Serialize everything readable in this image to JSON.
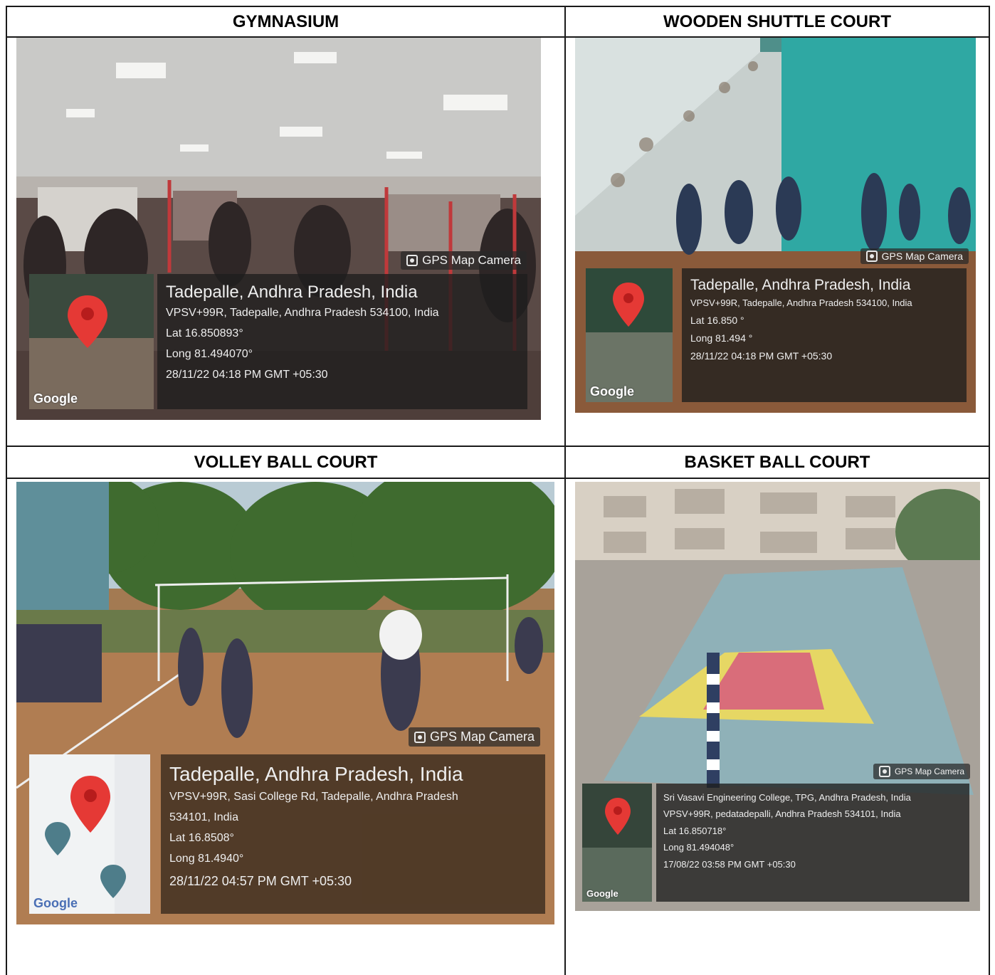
{
  "cells": [
    {
      "title": "GYMNASIUM",
      "badge": "GPS Map Camera",
      "place": "Tadepalle, Andhra Pradesh, India",
      "address": "VPSV+99R, Tadepalle, Andhra Pradesh 534100, India",
      "lat": "Lat 16.850893°",
      "long": "Long 81.494070°",
      "datetime": "28/11/22 04:18 PM GMT +05:30",
      "map_label": "Google"
    },
    {
      "title": "WOODEN SHUTTLE COURT",
      "badge": "GPS Map Camera",
      "place": "Tadepalle, Andhra Pradesh, India",
      "address": "VPSV+99R, Tadepalle, Andhra Pradesh 534100, India",
      "lat": "Lat 16.850 °",
      "long": "Long 81.494 °",
      "datetime": "28/11/22 04:18 PM GMT +05:30",
      "map_label": "Google"
    },
    {
      "title": "VOLLEY BALL COURT",
      "badge": "GPS Map Camera",
      "place": "Tadepalle, Andhra Pradesh, India",
      "address": "VPSV+99R, Sasi College Rd, Tadepalle, Andhra Pradesh",
      "address2": "534101, India",
      "lat": "Lat 16.8508°",
      "long": "Long 81.4940°",
      "datetime": "28/11/22 04:57 PM GMT +05:30",
      "map_label": "Google"
    },
    {
      "title": "BASKET BALL COURT",
      "badge": "GPS Map Camera",
      "place": "Sri Vasavi Engineering College, TPG, Andhra Pradesh, India",
      "address": "VPSV+99R, pedatadepalli, Andhra Pradesh 534101, India",
      "lat": "Lat 16.850718°",
      "long": "Long 81.494048°",
      "datetime": "17/08/22 03:58 PM GMT +05:30",
      "map_label": "Google"
    }
  ]
}
